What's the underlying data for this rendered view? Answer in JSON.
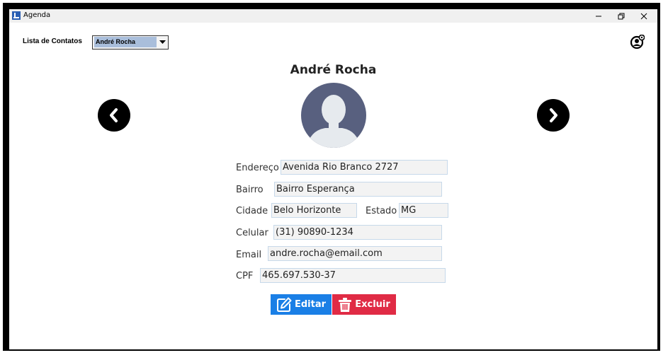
{
  "window": {
    "title": "Agenda",
    "minimize_glyph": "–",
    "close_glyph": "✕"
  },
  "contacts": {
    "label": "Lista de Contatos",
    "selected": "André Rocha"
  },
  "contact": {
    "name": "André Rocha",
    "fields": {
      "endereco": {
        "label": "Endereço",
        "value": "Avenida Rio Branco 2727"
      },
      "bairro": {
        "label": "Bairro",
        "value": "Bairro Esperança"
      },
      "cidade": {
        "label": "Cidade",
        "value": "Belo Horizonte"
      },
      "estado": {
        "label": "Estado",
        "value": "MG"
      },
      "celular": {
        "label": "Celular",
        "value": "(31) 90890-1234"
      },
      "email": {
        "label": "Email",
        "value": "andre.rocha@email.com"
      },
      "cpf": {
        "label": "CPF",
        "value": "465.697.530-37"
      }
    }
  },
  "actions": {
    "edit_label": "Editar",
    "delete_label": "Excluir"
  },
  "colors": {
    "edit_button": "#1a7fe6",
    "delete_button": "#e02b45",
    "avatar_bg": "#58607f",
    "selection": "#a9bedb"
  },
  "icons": [
    "app-icon",
    "minimize-icon",
    "restore-icon",
    "close-icon",
    "dropdown-arrow-icon",
    "user-settings-icon",
    "chevron-left-icon",
    "chevron-right-icon",
    "edit-icon",
    "trash-icon"
  ]
}
